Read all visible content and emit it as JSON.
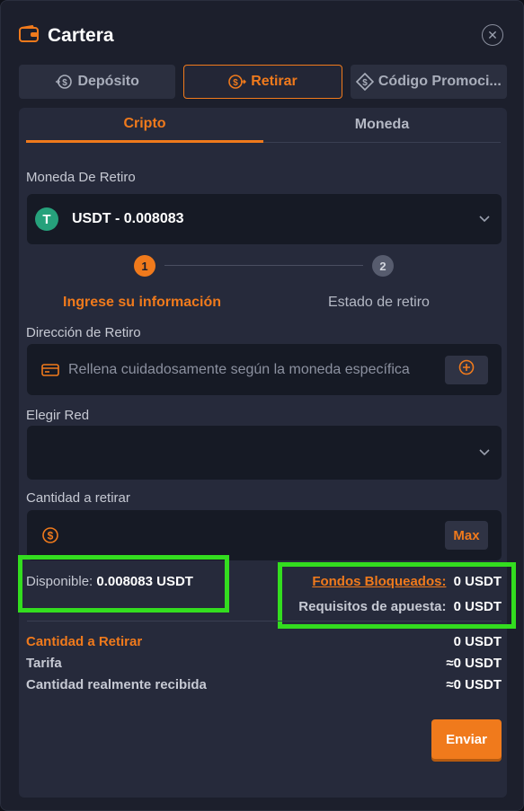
{
  "header": {
    "title": "Cartera",
    "close_icon": "close-icon"
  },
  "tabs": [
    {
      "label": "Depósito",
      "icon": "deposit-icon",
      "active": false
    },
    {
      "label": "Retirar",
      "icon": "withdraw-icon",
      "active": true
    },
    {
      "label": "Código Promoci...",
      "icon": "coupon-icon",
      "active": false
    }
  ],
  "subtabs": [
    {
      "label": "Cripto",
      "active": true
    },
    {
      "label": "Moneda",
      "active": false
    }
  ],
  "currency": {
    "label": "Moneda De Retiro",
    "coin_symbol": "T",
    "selected": "USDT - 0.008083"
  },
  "steps": [
    {
      "number": "1",
      "label": "Ingrese su información",
      "active": true
    },
    {
      "number": "2",
      "label": "Estado de retiro",
      "active": false
    }
  ],
  "address": {
    "label": "Dirección de Retiro",
    "placeholder": "Rellena cuidadosamente según la moneda específica"
  },
  "network": {
    "label": "Elegir Red",
    "value": ""
  },
  "amount": {
    "label": "Cantidad a retirar",
    "max_label": "Max"
  },
  "balance": {
    "available_label": "Disponible:",
    "available_value": "0.008083 USDT",
    "locked_label": "Fondos Bloqueados:",
    "locked_value": "0 USDT",
    "wager_label": "Requisitos de apuesta:",
    "wager_value": "0 USDT"
  },
  "summary": [
    {
      "label": "Cantidad a Retirar",
      "value": "0  USDT",
      "highlight": true
    },
    {
      "label": "Tarifa",
      "value": "≈0  USDT",
      "highlight": false
    },
    {
      "label": "Cantidad realmente recibida",
      "value": "≈0  USDT",
      "highlight": false
    }
  ],
  "submit_label": "Enviar",
  "colors": {
    "accent": "#f07a1c",
    "highlight_box": "#33dd1f",
    "coin": "#26a17b"
  }
}
